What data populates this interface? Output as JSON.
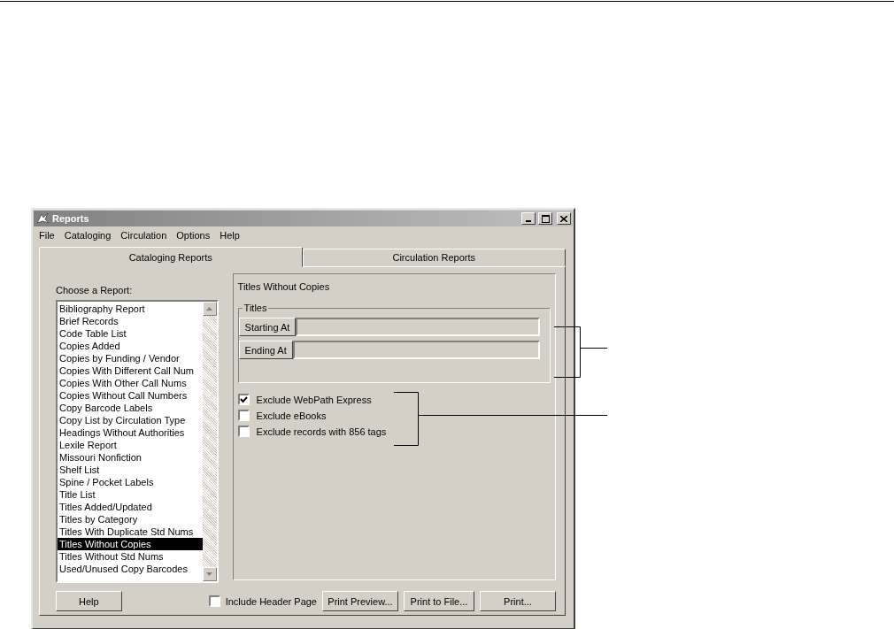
{
  "window": {
    "title": "Reports"
  },
  "menu": [
    "File",
    "Cataloging",
    "Circulation",
    "Options",
    "Help"
  ],
  "tabs": [
    {
      "label": "Cataloging Reports",
      "selected": true
    },
    {
      "label": "Circulation Reports",
      "selected": false
    }
  ],
  "report_list": {
    "label": "Choose a Report:",
    "items": [
      {
        "label": "Bibliography Report",
        "selected": false
      },
      {
        "label": "Brief Records",
        "selected": false
      },
      {
        "label": "Code Table List",
        "selected": false
      },
      {
        "label": "Copies Added",
        "selected": false
      },
      {
        "label": "Copies by Funding / Vendor",
        "selected": false
      },
      {
        "label": "Copies With Different Call Num",
        "selected": false
      },
      {
        "label": "Copies With Other Call Nums",
        "selected": false
      },
      {
        "label": "Copies Without Call Numbers",
        "selected": false
      },
      {
        "label": "Copy Barcode Labels",
        "selected": false
      },
      {
        "label": "Copy List by Circulation Type",
        "selected": false
      },
      {
        "label": "Headings Without Authorities",
        "selected": false
      },
      {
        "label": "Lexile Report",
        "selected": false
      },
      {
        "label": "Missouri Nonfiction",
        "selected": false
      },
      {
        "label": "Shelf List",
        "selected": false
      },
      {
        "label": "Spine / Pocket Labels",
        "selected": false
      },
      {
        "label": "Title List",
        "selected": false
      },
      {
        "label": "Titles Added/Updated",
        "selected": false
      },
      {
        "label": "Titles by Category",
        "selected": false
      },
      {
        "label": "Titles With Duplicate Std Nums",
        "selected": false
      },
      {
        "label": "Titles Without Copies",
        "selected": true
      },
      {
        "label": "Titles Without Std Nums",
        "selected": false
      },
      {
        "label": "Used/Unused Copy Barcodes",
        "selected": false
      }
    ]
  },
  "report_panel": {
    "title": "Titles Without Copies",
    "group": {
      "label": "Titles",
      "fields": [
        {
          "button": "Starting At"
        },
        {
          "button": "Ending At"
        }
      ]
    },
    "options": [
      {
        "label": "Exclude WebPath Express",
        "checked": true
      },
      {
        "label": "Exclude eBooks",
        "checked": false
      },
      {
        "label": "Exclude records with 856 tags",
        "checked": false
      }
    ]
  },
  "footer": {
    "help_button": "Help",
    "include_header": {
      "label": "Include Header Page",
      "checked": false
    },
    "buttons": [
      "Print Preview...",
      "Print to File...",
      "Print..."
    ]
  }
}
